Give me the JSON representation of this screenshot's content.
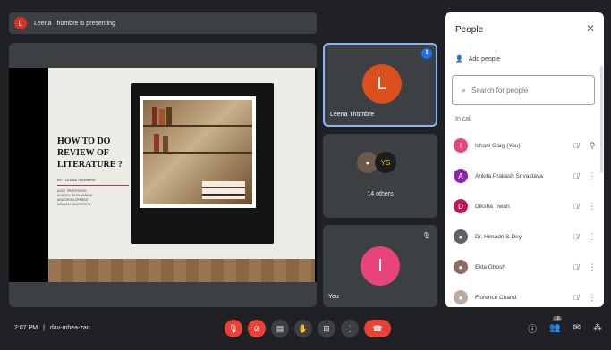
{
  "presenting_bar": {
    "avatar_letter": "L",
    "text": "Leena Thombre is presenting"
  },
  "slide": {
    "title_lines": [
      "HOW TO DO",
      "REVIEW OF",
      "LITERATURE ?"
    ],
    "byline": "BY - LEENA THOMBRE",
    "detail_lines": [
      "ASST. PROFESSOR",
      "SCHOOL OF PLANNING",
      "AND DEVELOPMENT",
      "NIRAMAY UNIVERSITY"
    ]
  },
  "tiles": {
    "presenter": {
      "letter": "L",
      "name": "Leena Thombre",
      "color": "#d9501e"
    },
    "group": {
      "label": "14 others",
      "avatar2_initials": "YS"
    },
    "you": {
      "letter": "I",
      "name": "You",
      "color": "#e8437a"
    }
  },
  "people_panel": {
    "title": "People",
    "add_people": "Add people",
    "search_placeholder": "Search for people",
    "section": "In call",
    "people": [
      {
        "initial": "I",
        "name": "Ishani Garg (You)",
        "color": "#e8437a"
      },
      {
        "initial": "A",
        "name": "Ankita Prakash Srivastava",
        "color": "#8e24aa"
      },
      {
        "initial": "D",
        "name": "Diksha Tiwari",
        "color": "#c2185b"
      },
      {
        "initial": "",
        "name": "Dr. Himadri & Dey",
        "color": "#5f6368"
      },
      {
        "initial": "",
        "name": "Ekta Ghosh",
        "color": "#8d6e63"
      },
      {
        "initial": "",
        "name": "Florence Chand",
        "color": "#bcaaa4"
      }
    ]
  },
  "bottom_bar": {
    "time": "2:07 PM",
    "separator": "|",
    "meeting_code": "dav-mhea-zan",
    "participant_count": "16"
  }
}
